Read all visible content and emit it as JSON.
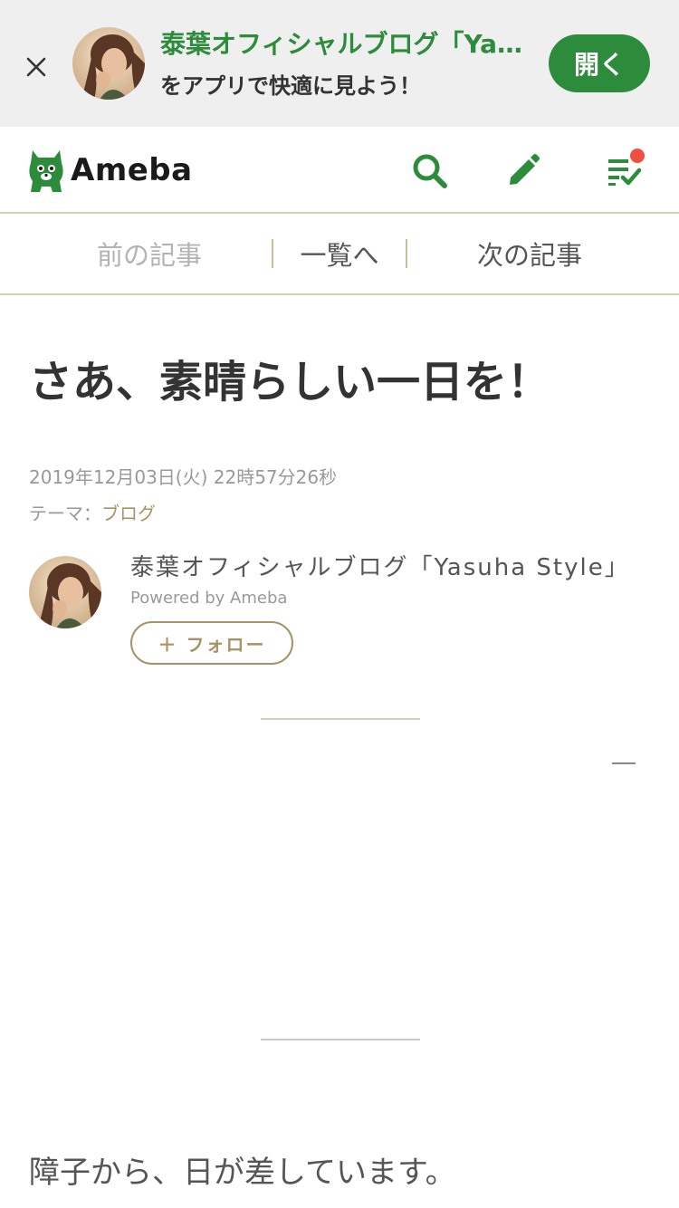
{
  "app_banner": {
    "title": "泰葉オフィシャルブログ「Yasuha Style」",
    "subtitle": "をアプリで快適に見よう！",
    "open_button": "開く",
    "close_icon": "close-icon"
  },
  "header": {
    "logo_text": "Ameba",
    "icons": [
      "search-icon",
      "pencil-icon",
      "reading-list-icon"
    ],
    "notification_color": "#f04e3e",
    "accent_color": "#2d8c3c"
  },
  "article_nav": {
    "prev": "前の記事",
    "list": "一覧へ",
    "next": "次の記事"
  },
  "article": {
    "title": "さあ、素晴らしい一日を！",
    "date": "2019年12月03日(火) 22時57分26秒",
    "theme_label": "テーマ：",
    "theme": "ブログ",
    "author_name": "泰葉オフィシャルブログ「Yasuha Style」",
    "powered_by": "Powered by Ameba",
    "follow_button": "＋ フォロー",
    "body_text": "障子から、日が差しています。"
  }
}
